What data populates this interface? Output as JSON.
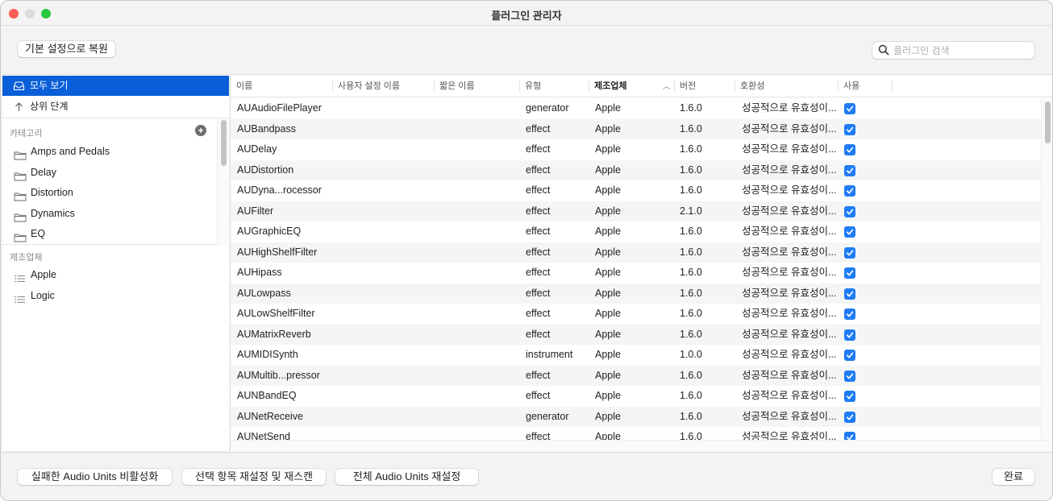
{
  "window": {
    "title": "플러그인 관리자"
  },
  "toolbar": {
    "restore_defaults_label": "기본 설정으로 복원",
    "search_placeholder": "플러그인 검색",
    "search_value": ""
  },
  "sidebar": {
    "show_all_label": "모두 보기",
    "up_level_label": "상위 단계",
    "categories_header": "카테고리",
    "categories": [
      {
        "label": "Amps and Pedals",
        "icon": "folder-icon"
      },
      {
        "label": "Delay",
        "icon": "folder-icon"
      },
      {
        "label": "Distortion",
        "icon": "folder-icon"
      },
      {
        "label": "Dynamics",
        "icon": "folder-icon"
      },
      {
        "label": "EQ",
        "icon": "folder-icon"
      }
    ],
    "manufacturers_header": "제조업체",
    "manufacturers": [
      {
        "label": "Apple",
        "icon": "list-icon"
      },
      {
        "label": "Logic",
        "icon": "list-icon"
      }
    ]
  },
  "table": {
    "columns": [
      "이름",
      "사용자 설정 이름",
      "짧은 이름",
      "유형",
      "제조업체",
      "버전",
      "호환성",
      "사용"
    ],
    "sorted_column": "제조업체",
    "sort_direction": "ascending",
    "rows": [
      {
        "name": "AUAudioFilePlayer",
        "custom_name": "",
        "short_name": "",
        "type": "generator",
        "manufacturer": "Apple",
        "version": "1.6.0",
        "compatibility": "성공적으로 유효성이...",
        "use": true
      },
      {
        "name": "AUBandpass",
        "custom_name": "",
        "short_name": "",
        "type": "effect",
        "manufacturer": "Apple",
        "version": "1.6.0",
        "compatibility": "성공적으로 유효성이...",
        "use": true
      },
      {
        "name": "AUDelay",
        "custom_name": "",
        "short_name": "",
        "type": "effect",
        "manufacturer": "Apple",
        "version": "1.6.0",
        "compatibility": "성공적으로 유효성이...",
        "use": true
      },
      {
        "name": "AUDistortion",
        "custom_name": "",
        "short_name": "",
        "type": "effect",
        "manufacturer": "Apple",
        "version": "1.6.0",
        "compatibility": "성공적으로 유효성이...",
        "use": true
      },
      {
        "name": "AUDyna...rocessor",
        "custom_name": "",
        "short_name": "",
        "type": "effect",
        "manufacturer": "Apple",
        "version": "1.6.0",
        "compatibility": "성공적으로 유효성이...",
        "use": true
      },
      {
        "name": "AUFilter",
        "custom_name": "",
        "short_name": "",
        "type": "effect",
        "manufacturer": "Apple",
        "version": "2.1.0",
        "compatibility": "성공적으로 유효성이...",
        "use": true
      },
      {
        "name": "AUGraphicEQ",
        "custom_name": "",
        "short_name": "",
        "type": "effect",
        "manufacturer": "Apple",
        "version": "1.6.0",
        "compatibility": "성공적으로 유효성이...",
        "use": true
      },
      {
        "name": "AUHighShelfFilter",
        "custom_name": "",
        "short_name": "",
        "type": "effect",
        "manufacturer": "Apple",
        "version": "1.6.0",
        "compatibility": "성공적으로 유효성이...",
        "use": true
      },
      {
        "name": "AUHipass",
        "custom_name": "",
        "short_name": "",
        "type": "effect",
        "manufacturer": "Apple",
        "version": "1.6.0",
        "compatibility": "성공적으로 유효성이...",
        "use": true
      },
      {
        "name": "AULowpass",
        "custom_name": "",
        "short_name": "",
        "type": "effect",
        "manufacturer": "Apple",
        "version": "1.6.0",
        "compatibility": "성공적으로 유효성이...",
        "use": true
      },
      {
        "name": "AULowShelfFilter",
        "custom_name": "",
        "short_name": "",
        "type": "effect",
        "manufacturer": "Apple",
        "version": "1.6.0",
        "compatibility": "성공적으로 유효성이...",
        "use": true
      },
      {
        "name": "AUMatrixReverb",
        "custom_name": "",
        "short_name": "",
        "type": "effect",
        "manufacturer": "Apple",
        "version": "1.6.0",
        "compatibility": "성공적으로 유효성이...",
        "use": true
      },
      {
        "name": "AUMIDISynth",
        "custom_name": "",
        "short_name": "",
        "type": "instrument",
        "manufacturer": "Apple",
        "version": "1.0.0",
        "compatibility": "성공적으로 유효성이...",
        "use": true
      },
      {
        "name": "AUMultib...pressor",
        "custom_name": "",
        "short_name": "",
        "type": "effect",
        "manufacturer": "Apple",
        "version": "1.6.0",
        "compatibility": "성공적으로 유효성이...",
        "use": true
      },
      {
        "name": "AUNBandEQ",
        "custom_name": "",
        "short_name": "",
        "type": "effect",
        "manufacturer": "Apple",
        "version": "1.6.0",
        "compatibility": "성공적으로 유효성이...",
        "use": true
      },
      {
        "name": "AUNetReceive",
        "custom_name": "",
        "short_name": "",
        "type": "generator",
        "manufacturer": "Apple",
        "version": "1.6.0",
        "compatibility": "성공적으로 유효성이...",
        "use": true
      },
      {
        "name": "AUNetSend",
        "custom_name": "",
        "short_name": "",
        "type": "effect",
        "manufacturer": "Apple",
        "version": "1.6.0",
        "compatibility": "성공적으로 유효성이...",
        "use": true
      }
    ]
  },
  "footer": {
    "disable_failed_label": "실패한 Audio Units 비활성화",
    "reset_rescan_label": "선택 항목 재설정 및 재스캔",
    "reset_all_label": "전체 Audio Units 재설정",
    "done_label": "완료"
  },
  "colors": {
    "accent": "#0a5fd8",
    "checkbox": "#1f7cf5",
    "row_alt": "#f4f5f5"
  }
}
